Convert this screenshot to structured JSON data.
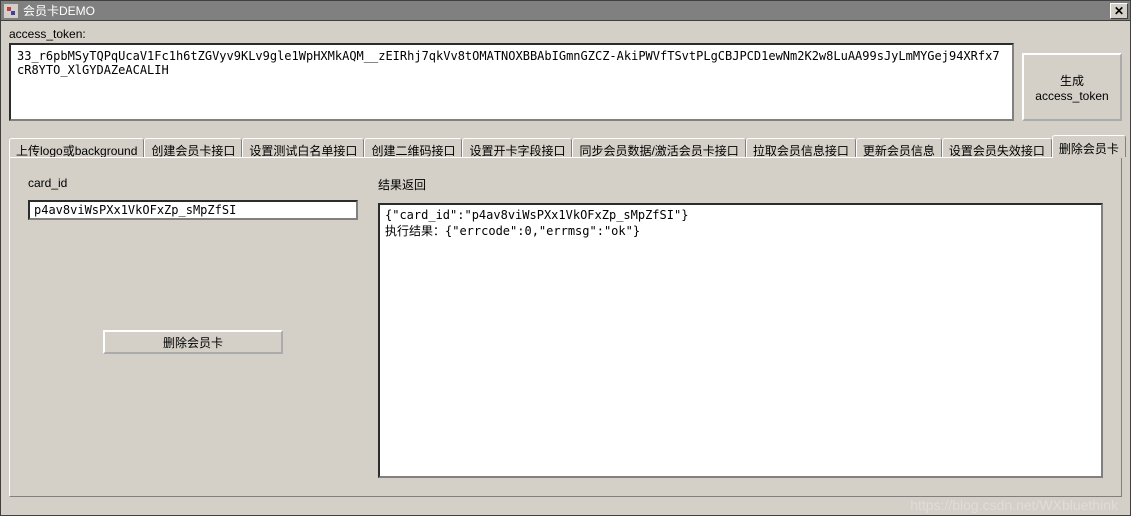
{
  "window": {
    "title": "会员卡DEMO"
  },
  "access_token": {
    "label": "access_token:",
    "value": "33_r6pbMSyTQPqUcaV1Fc1h6tZGVyv9KLv9gle1WpHXMkAQM__zEIRhj7qkVv8tOMATNOXBBAbIGmnGZCZ-AkiPWVfTSvtPLgCBJPCD1ewNm2K2w8LuAA99sJyLmMYGej94XRfx7cR8YTO_XlGYDAZeACALIH",
    "gen_button": "生成\naccess_token"
  },
  "tabs": [
    {
      "label": "上传logo或background",
      "active": false
    },
    {
      "label": "创建会员卡接口",
      "active": false
    },
    {
      "label": "设置测试白名单接口",
      "active": false
    },
    {
      "label": "创建二维码接口",
      "active": false
    },
    {
      "label": "设置开卡字段接口",
      "active": false
    },
    {
      "label": "同步会员数据/激活会员卡接口",
      "active": false
    },
    {
      "label": "拉取会员信息接口",
      "active": false
    },
    {
      "label": "更新会员信息",
      "active": false
    },
    {
      "label": "设置会员失效接口",
      "active": false
    },
    {
      "label": "删除会员卡",
      "active": true
    }
  ],
  "panel": {
    "card_id_label": "card_id",
    "card_id_value": "p4av8viWsPXx1VkOFxZp_sMpZfSI",
    "result_label": "结果返回",
    "result_value": "{\"card_id\":\"p4av8viWsPXx1VkOFxZp_sMpZfSI\"}\n执行结果：{\"errcode\":0,\"errmsg\":\"ok\"}",
    "delete_button": "删除会员卡"
  },
  "watermark": "https://blog.csdn.net/WXbluethink"
}
